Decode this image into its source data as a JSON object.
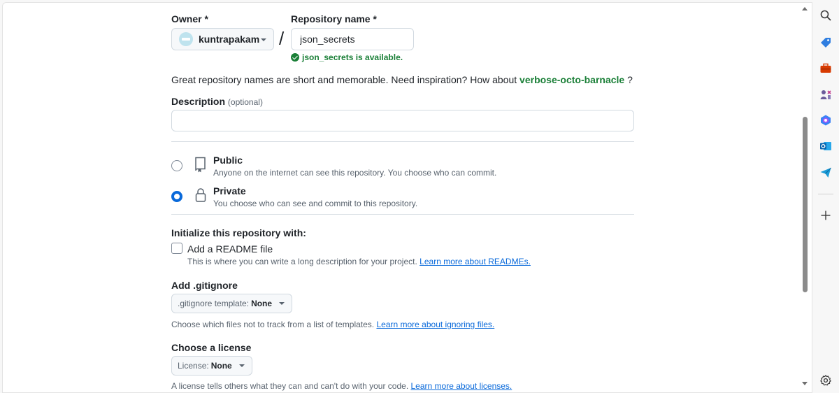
{
  "form": {
    "owner_label": "Owner *",
    "owner_value": "kuntrapakam",
    "separator": "/",
    "repo_label": "Repository name *",
    "repo_value": "json_secrets",
    "availability": "json_secrets is available.",
    "hint_prefix": "Great repository names are short and memorable. Need inspiration? How about",
    "hint_suggestion": "verbose-octo-barnacle",
    "hint_suffix": "?",
    "description_label": "Description",
    "description_optional": "(optional)",
    "description_value": ""
  },
  "visibility": {
    "public_title": "Public",
    "public_desc": "Anyone on the internet can see this repository. You choose who can commit.",
    "private_title": "Private",
    "private_desc": "You choose who can see and commit to this repository.",
    "selected": "Private"
  },
  "init": {
    "heading": "Initialize this repository with:",
    "readme_label": "Add a README file",
    "readme_checked": false,
    "readme_desc": "This is where you can write a long description for your project.",
    "readme_link": "Learn more about READMEs.",
    "gitignore_heading": "Add .gitignore",
    "gitignore_select_prefix": ".gitignore template:",
    "gitignore_select_value": "None",
    "gitignore_desc": "Choose which files not to track from a list of templates.",
    "gitignore_link": "Learn more about ignoring files.",
    "license_heading": "Choose a license",
    "license_select_prefix": "License:",
    "license_select_value": "None",
    "license_desc": "A license tells others what they can and can't do with your code.",
    "license_link": "Learn more about licenses."
  },
  "sidebar_icons": [
    "search-icon",
    "tag-icon",
    "toolbox-icon",
    "games-icon",
    "copilot-icon",
    "outlook-icon",
    "send-icon",
    "add-icon",
    "settings-icon"
  ],
  "colors": {
    "success_green": "#1a7f37",
    "link_blue": "#0969da",
    "radio_selected": "#0969da"
  }
}
